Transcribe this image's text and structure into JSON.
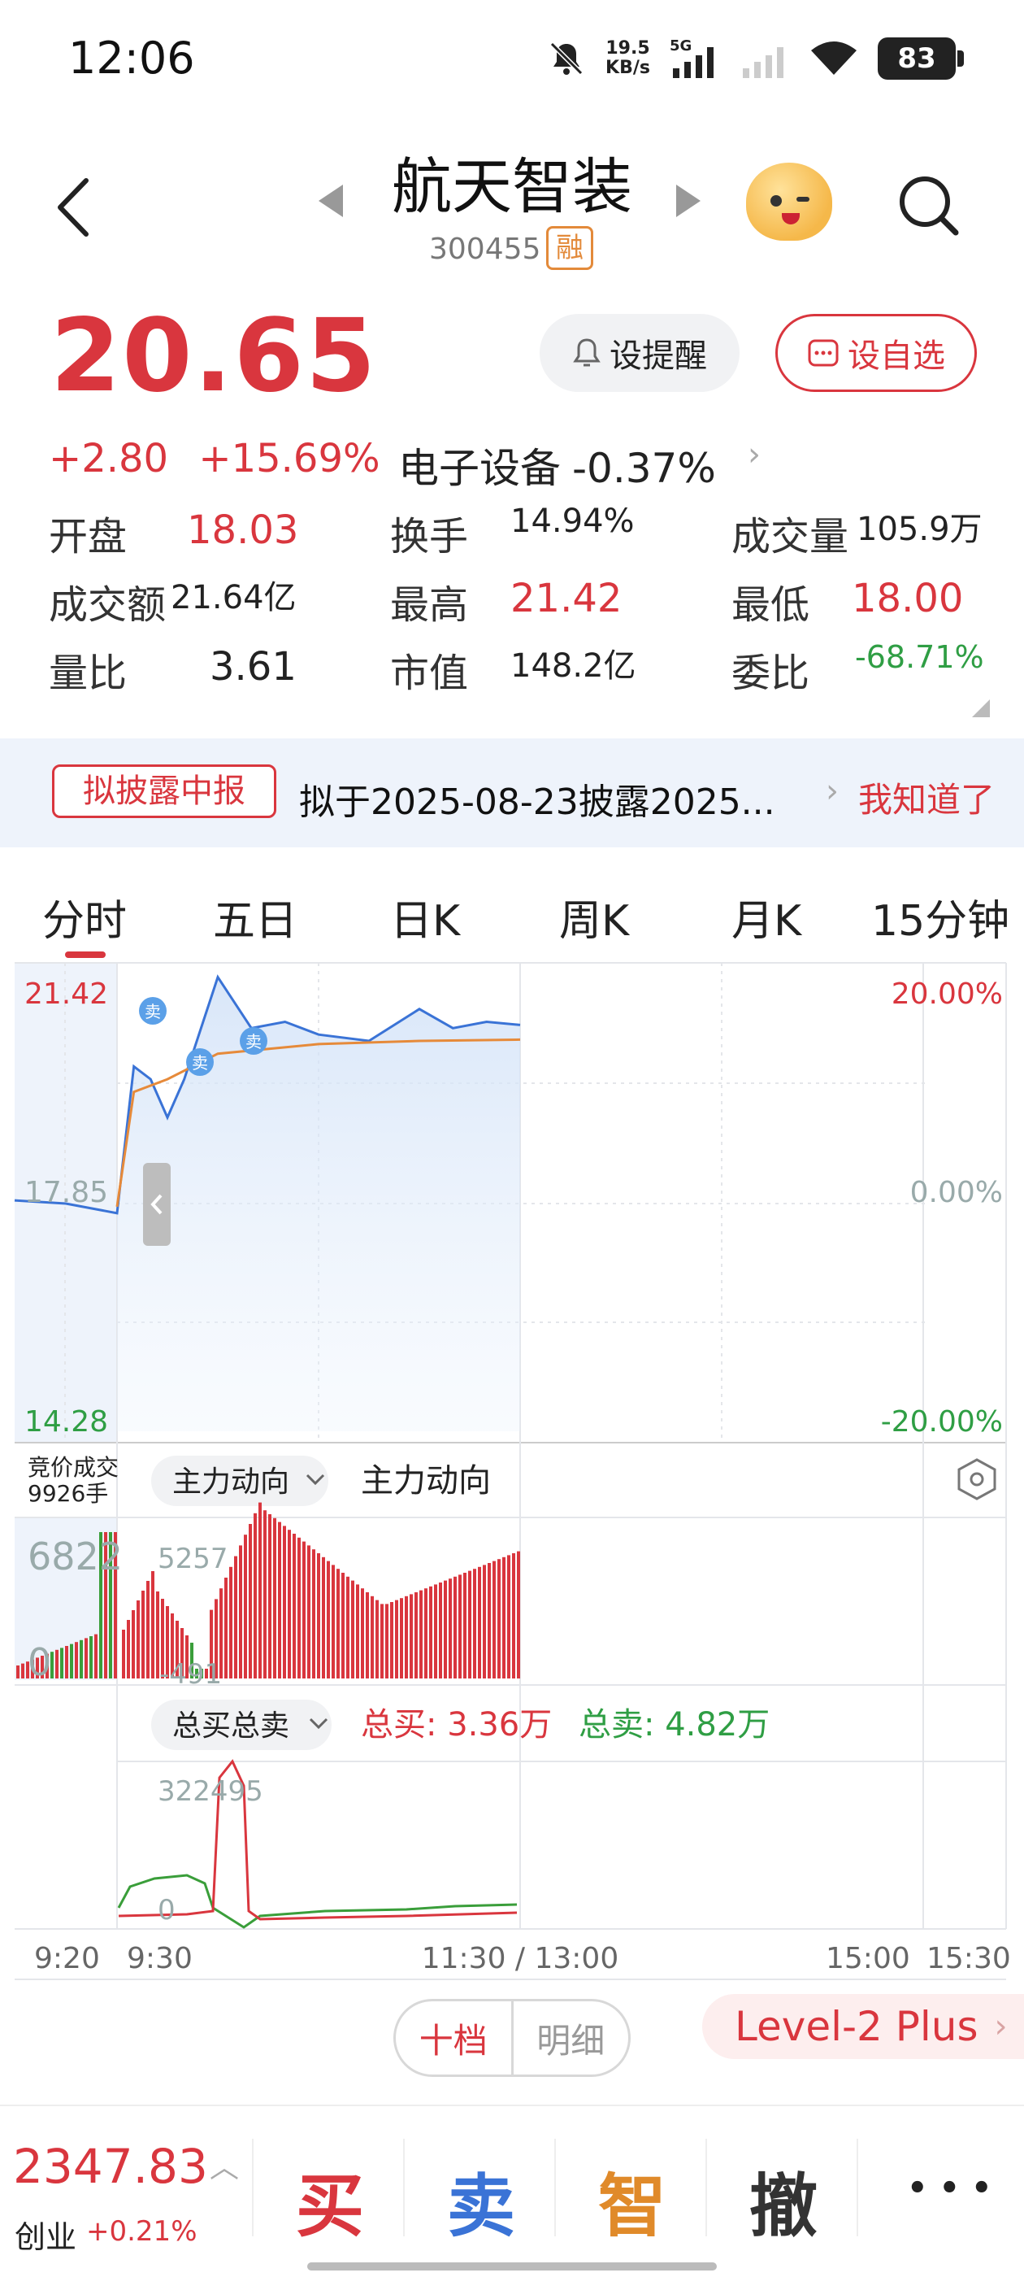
{
  "status_bar": {
    "time": "12:06",
    "net_speed_value": "19.5",
    "net_speed_unit": "KB/s",
    "network": "5G",
    "battery": "83"
  },
  "header": {
    "stock_name": "航天智装",
    "stock_code": "300455",
    "badge": "融"
  },
  "quote": {
    "price": "20.65",
    "change": "+2.80",
    "change_pct": "+15.69%",
    "sector_name": "电子设备",
    "sector_change": "-0.37%",
    "alert_button": "设提醒",
    "watch_button": "设自选",
    "colors": {
      "up": "#d9363e",
      "down": "#2f9e44"
    }
  },
  "stats": [
    {
      "label": "开盘",
      "value": "18.03",
      "tone": "red"
    },
    {
      "label": "换手",
      "value": "14.94%",
      "tone": "plain"
    },
    {
      "label": "成交量",
      "value": "105.9万",
      "tone": "plain"
    },
    {
      "label": "成交额",
      "value": "21.64亿",
      "tone": "plain"
    },
    {
      "label": "最高",
      "value": "21.42",
      "tone": "red"
    },
    {
      "label": "最低",
      "value": "18.00",
      "tone": "red"
    },
    {
      "label": "量比",
      "value": "3.61",
      "tone": "plain"
    },
    {
      "label": "市值",
      "value": "148.2亿",
      "tone": "plain"
    },
    {
      "label": "委比",
      "value": "-68.71%",
      "tone": "green"
    }
  ],
  "notice": {
    "tag": "拟披露中报",
    "text": "拟于2025-08-23披露2025...",
    "dismiss": "我知道了"
  },
  "tabs": [
    "分时",
    "五日",
    "日K",
    "周K",
    "月K",
    "15分钟"
  ],
  "active_tab": "分时",
  "price_chart": {
    "y_high": "21.42",
    "y_mid": "17.85",
    "y_low": "14.28",
    "pct_high": "20.00%",
    "pct_mid": "0.00%",
    "pct_low": "-20.00%",
    "trade_marker": "卖"
  },
  "volume_panel": {
    "auction_label": "竞价成交",
    "auction_volume": "9926手",
    "selector": "主力动向",
    "title": "主力动向",
    "left_axis_top": "6822",
    "left_axis_zero": "0",
    "peak_label": "5257",
    "low_label": "-491"
  },
  "buy_sell_panel": {
    "selector": "总买总卖",
    "total_buy": "总买: 3.36万",
    "total_sell": "总卖: 4.82万",
    "peak_label": "322495",
    "zero_label": "0"
  },
  "time_axis": [
    "9:20",
    "9:30",
    "11:30 / 13:00",
    "15:00",
    "15:30"
  ],
  "chart_data": {
    "type": "line",
    "title": "",
    "xlabel": "",
    "ylabel": "",
    "ylim": [
      14.28,
      21.42
    ],
    "y_reference": 17.85,
    "series": [
      {
        "x": [
          "9:20",
          "9:25",
          "9:30",
          "9:35",
          "9:40",
          "9:45",
          "9:50",
          "10:00",
          "10:10",
          "10:20",
          "10:30",
          "10:45",
          "11:00",
          "11:10",
          "11:20",
          "11:30"
        ],
        "values": [
          17.9,
          17.85,
          17.7,
          20.0,
          19.8,
          19.2,
          19.8,
          21.4,
          20.6,
          20.7,
          20.5,
          20.4,
          20.9,
          20.6,
          20.7,
          20.65
        ]
      },
      {
        "x": [
          "9:30",
          "9:35",
          "9:45",
          "10:00",
          "10:30",
          "11:00",
          "11:30"
        ],
        "values": [
          17.8,
          19.6,
          19.8,
          20.2,
          20.35,
          20.4,
          20.42
        ]
      }
    ]
  },
  "order_book": {
    "tab_active": "十档",
    "tab_inactive": "明细",
    "level2": "Level-2 Plus"
  },
  "bottom_bar": {
    "index_value": "2347.83",
    "index_name": "创业",
    "index_change": "+0.21%",
    "buy": "买",
    "sell": "卖",
    "smart": "智",
    "cancel": "撤",
    "more": "• • •"
  }
}
